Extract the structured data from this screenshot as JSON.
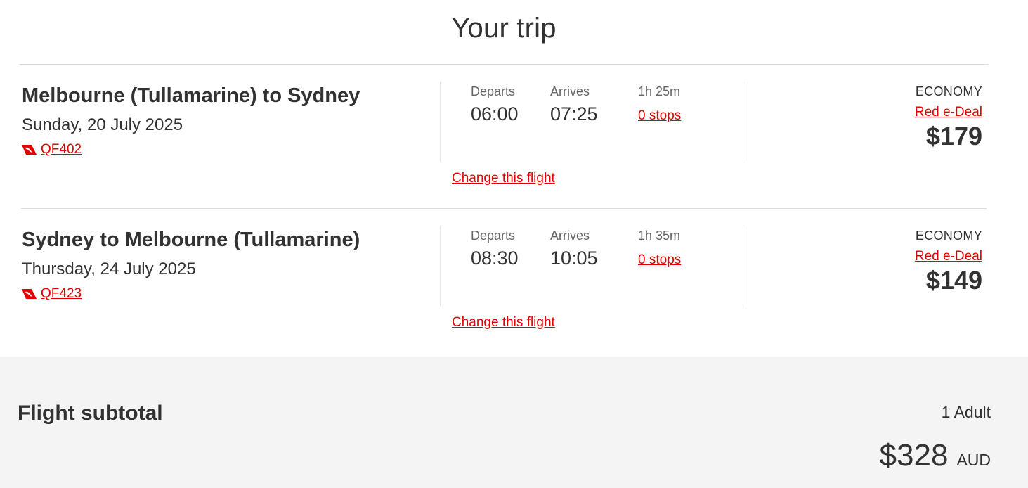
{
  "title": "Your trip",
  "colors": {
    "accent": "#e40000",
    "text": "#323232",
    "muted": "#666666",
    "subtotal_bg": "#f4f4f4"
  },
  "flights": [
    {
      "route": "Melbourne (Tullamarine) to Sydney",
      "date": "Sunday, 20 July 2025",
      "airline_icon": "qantas-kangaroo-icon",
      "flight_number": "QF402",
      "departs_label": "Departs",
      "departs_time": "06:00",
      "arrives_label": "Arrives",
      "arrives_time": "07:25",
      "duration": "1h 25m",
      "stops": "0 stops",
      "cabin": "ECONOMY",
      "fare_type": "Red e-Deal",
      "price": "$179",
      "change_link": "Change this flight"
    },
    {
      "route": "Sydney to Melbourne (Tullamarine)",
      "date": "Thursday, 24 July 2025",
      "airline_icon": "qantas-kangaroo-icon",
      "flight_number": "QF423",
      "departs_label": "Departs",
      "departs_time": "08:30",
      "arrives_label": "Arrives",
      "arrives_time": "10:05",
      "duration": "1h 35m",
      "stops": "0 stops",
      "cabin": "ECONOMY",
      "fare_type": "Red e-Deal",
      "price": "$149",
      "change_link": "Change this flight"
    }
  ],
  "subtotal": {
    "label": "Flight subtotal",
    "passengers": "1 Adult",
    "amount": "$328",
    "currency": "AUD"
  }
}
